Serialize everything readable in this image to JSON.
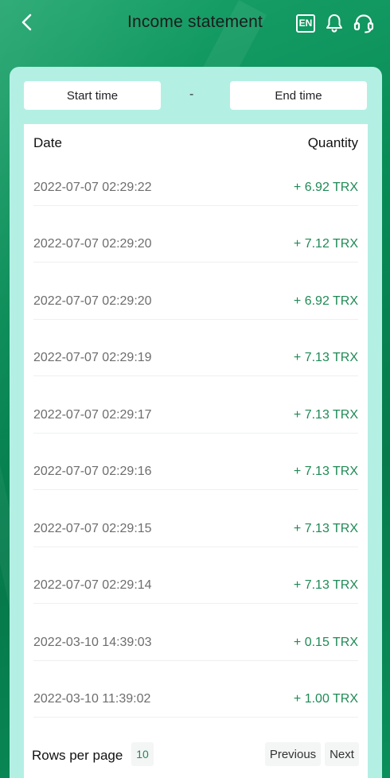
{
  "header": {
    "title": "Income statement",
    "language_badge": "EN",
    "icons": [
      "chevron-left-icon",
      "language-icon",
      "bell-icon",
      "headset-icon"
    ]
  },
  "filters": {
    "start_label": "Start time",
    "separator": "-",
    "end_label": "End time"
  },
  "table": {
    "columns": [
      "Date",
      "Quantity"
    ],
    "rows": [
      {
        "date": "2022-07-07 02:29:22",
        "quantity": "+ 6.92 TRX"
      },
      {
        "date": "2022-07-07 02:29:20",
        "quantity": "+ 7.12 TRX"
      },
      {
        "date": "2022-07-07 02:29:20",
        "quantity": "+ 6.92 TRX"
      },
      {
        "date": "2022-07-07 02:29:19",
        "quantity": "+ 7.13 TRX"
      },
      {
        "date": "2022-07-07 02:29:17",
        "quantity": "+ 7.13 TRX"
      },
      {
        "date": "2022-07-07 02:29:16",
        "quantity": "+ 7.13 TRX"
      },
      {
        "date": "2022-07-07 02:29:15",
        "quantity": "+ 7.13 TRX"
      },
      {
        "date": "2022-07-07 02:29:14",
        "quantity": "+ 7.13 TRX"
      },
      {
        "date": "2022-03-10 14:39:03",
        "quantity": "+ 0.15 TRX"
      },
      {
        "date": "2022-03-10 11:39:02",
        "quantity": "+ 1.00 TRX"
      }
    ]
  },
  "pagination": {
    "rows_per_page_label": "Rows per page",
    "rows_per_page_value": "10",
    "previous_label": "Previous",
    "next_label": "Next"
  },
  "colors": {
    "background": "#0b8a5a",
    "card": "#b4efe4",
    "positive_amount": "#1f8a55"
  }
}
